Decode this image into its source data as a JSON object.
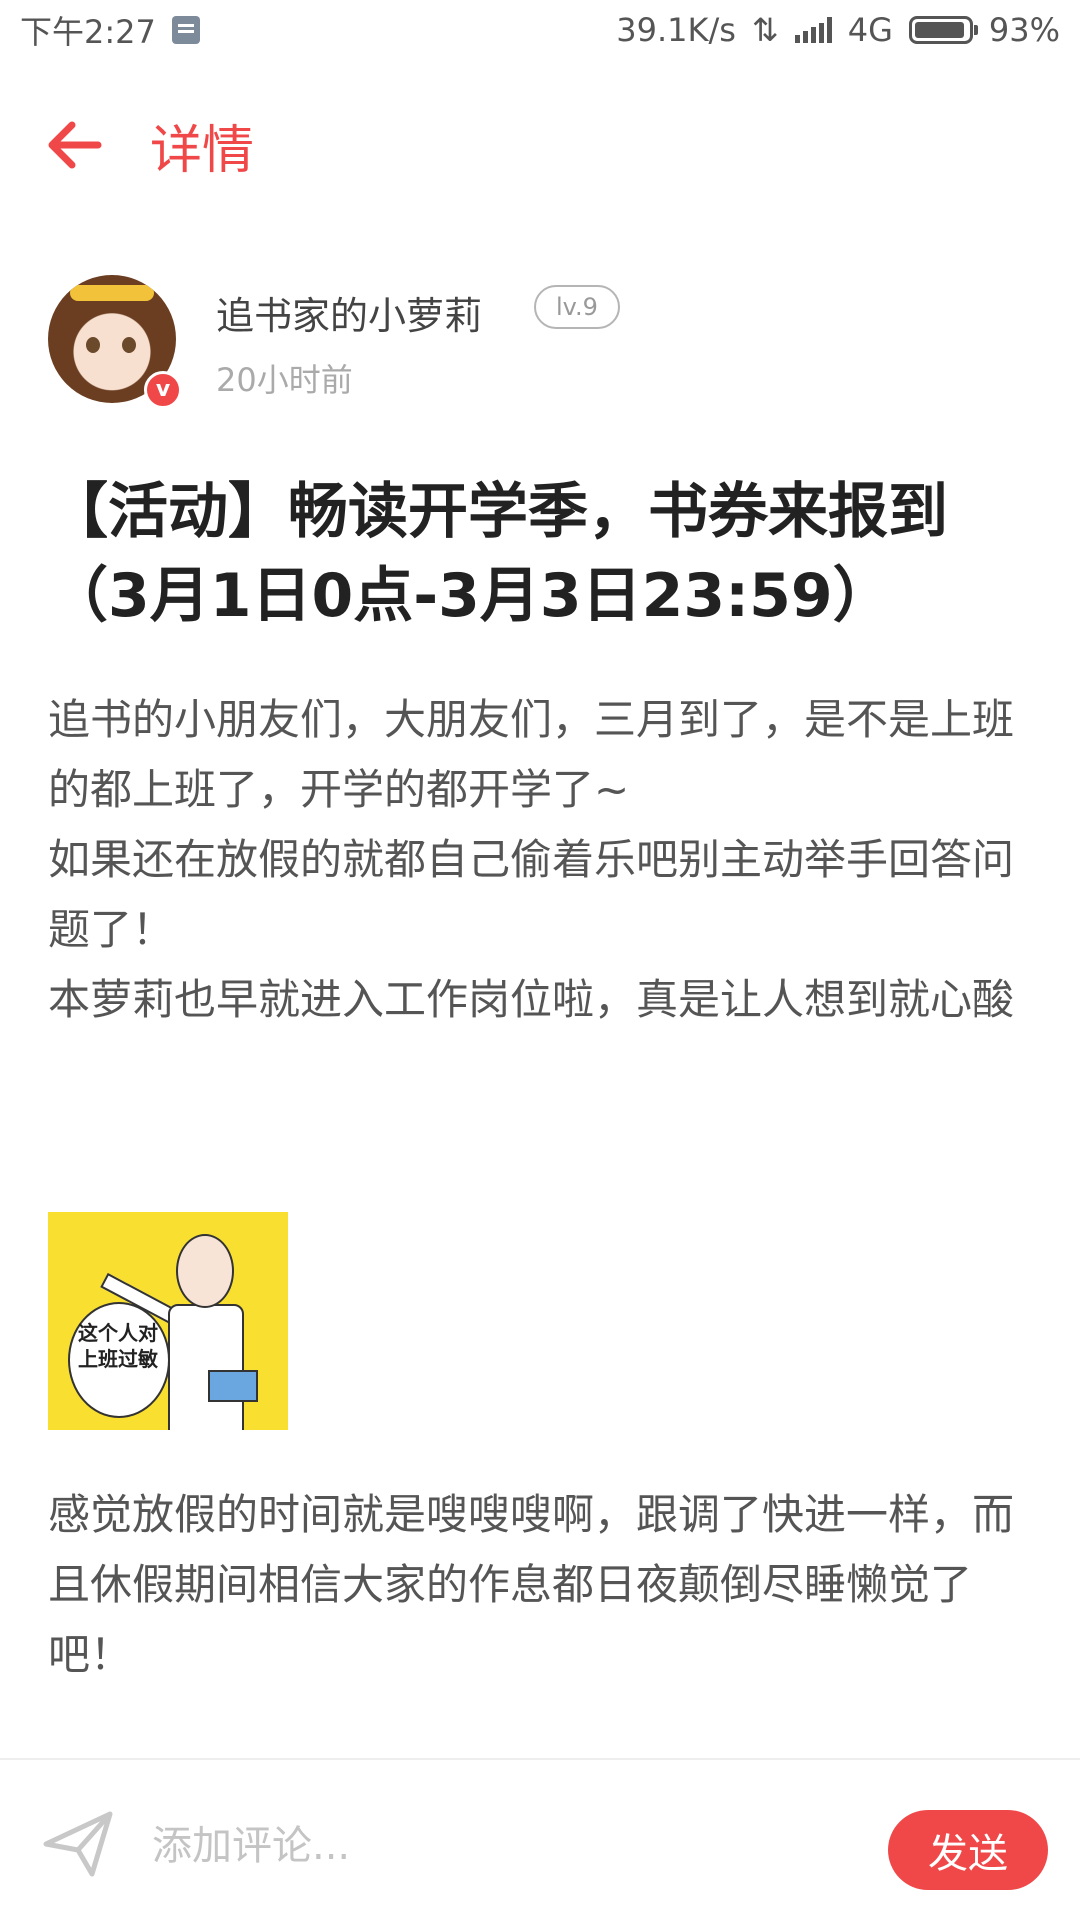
{
  "status_bar": {
    "time": "下午2:27",
    "net_speed": "39.1K/s",
    "network": "4G",
    "battery": "93%"
  },
  "header": {
    "title": "详情"
  },
  "author": {
    "name": "追书家的小萝莉",
    "level": "lv.9",
    "verified_mark": "v",
    "time": "20小时前"
  },
  "post": {
    "title": "【活动】畅读开学季，书券来报到（3月1日0点-3月3日23:59）",
    "paragraph1": "追书的小朋友们，大朋友们，三月到了，是不是上班的都上班了，开学的都开学了~\n如果还在放假的就都自己偷着乐吧别主动举手回答问题了！\n本萝莉也早就进入工作岗位啦，真是让人想到就心酸",
    "image_text": "这个人对上班过敏",
    "paragraph2": "感觉放假的时间就是嗖嗖嗖啊，跟调了快进一样，而且休假期间相信大家的作息都日夜颠倒尽睡懒觉了吧！"
  },
  "comment": {
    "placeholder": "添加评论...",
    "send_label": "发送"
  },
  "colors": {
    "accent": "#f04848"
  },
  "icons": {
    "back": "back-arrow-icon",
    "send": "paper-plane-icon"
  }
}
